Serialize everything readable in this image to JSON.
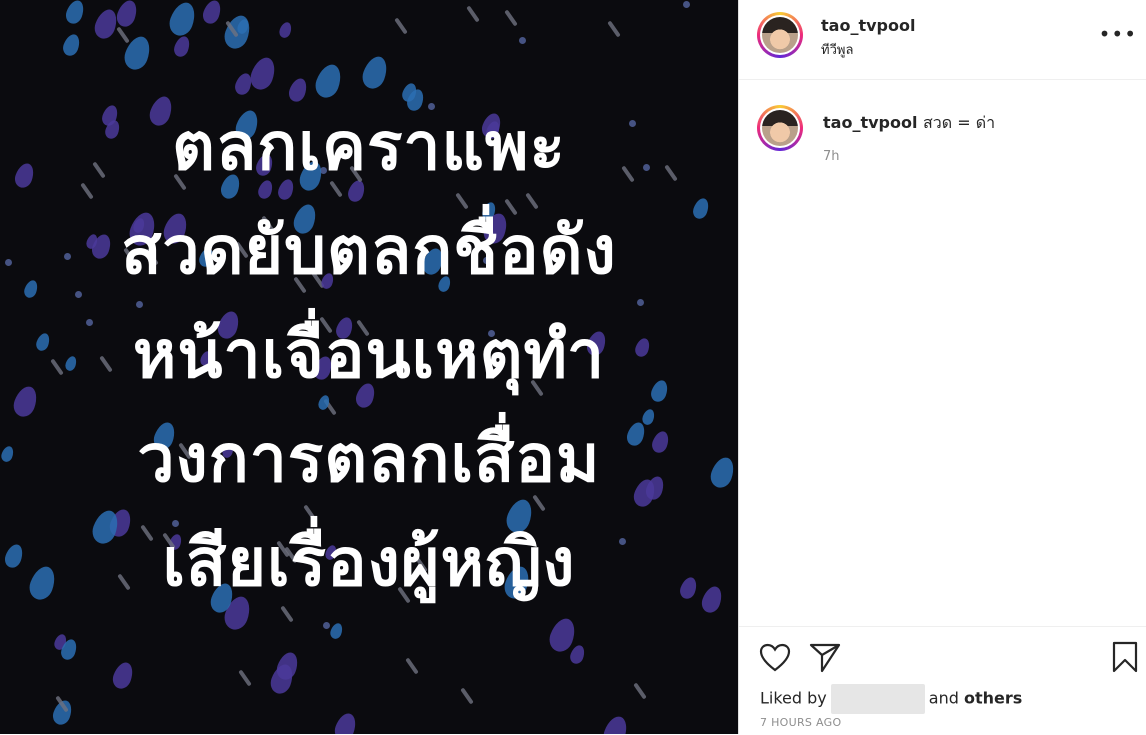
{
  "poster": {
    "lines": [
      "ตลกเคราแพะ",
      "สวดยับตลกชื่อดัง",
      "หน้าเจื่อนเหตุทำ",
      "วงการตลกเสื่อม",
      "เสียเรื่องผู้หญิง"
    ],
    "background": "#0b0b0f"
  },
  "post_header": {
    "username": "tao_tvpool",
    "location": "ทีวีพูล",
    "more_icon": "more-options-icon"
  },
  "caption": {
    "username": "tao_tvpool",
    "text": "สวด = ด่า",
    "time": "7h"
  },
  "actions": {
    "like_icon": "heart-icon",
    "share_icon": "send-icon",
    "save_icon": "bookmark-icon",
    "liked_by_prefix": "Liked by",
    "liked_by_suffix": "and",
    "liked_by_others": "others",
    "timestamp": "7 HOURS AGO"
  }
}
